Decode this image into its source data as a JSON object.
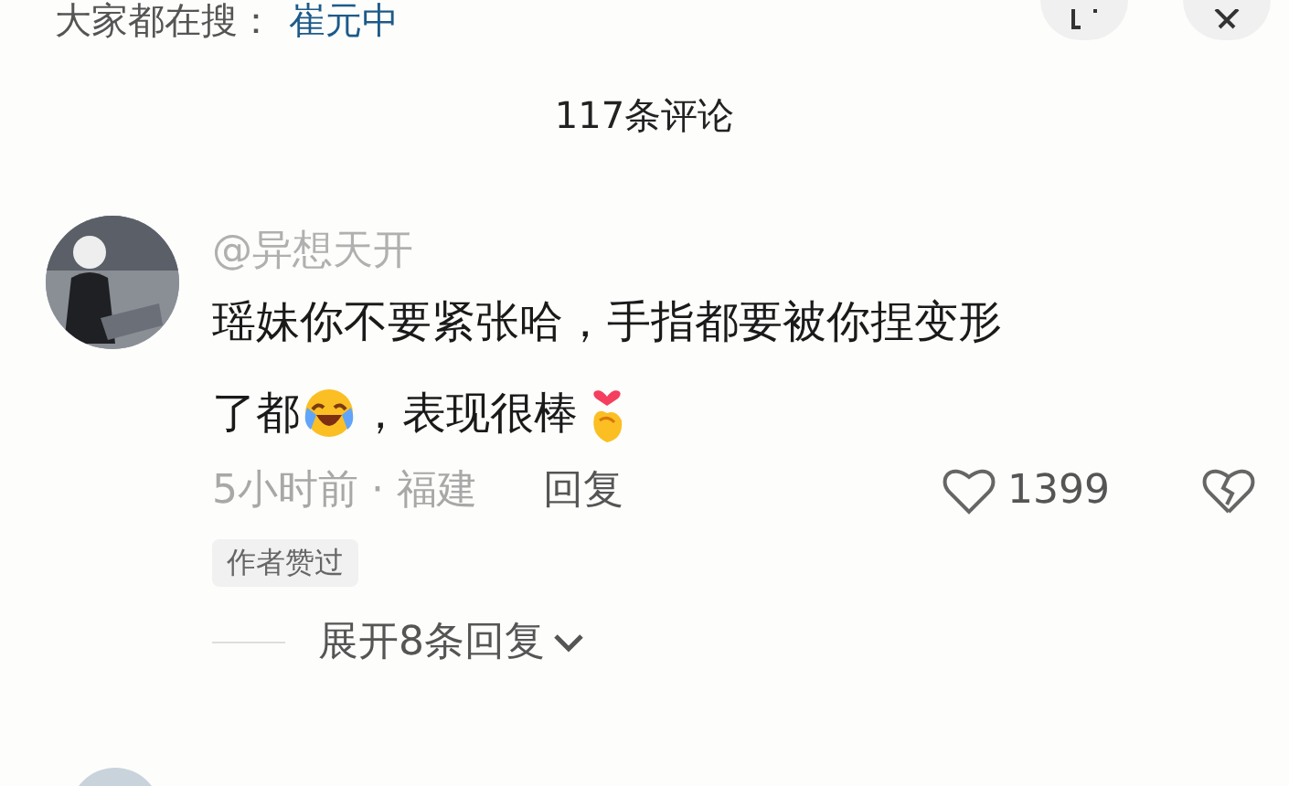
{
  "search_hint": {
    "label": "大家都在搜：",
    "term": "崔元中"
  },
  "title": "117条评论",
  "comment": {
    "username": "@异想天开",
    "lines": [
      [
        {
          "kind": "text",
          "text": "瑶妹你不要紧张哈，手指都要被你捏变形"
        }
      ],
      [
        {
          "kind": "text",
          "text": "了都"
        },
        {
          "kind": "laugh_emoji"
        },
        {
          "kind": "text",
          "text": "，表现很棒"
        },
        {
          "kind": "finger_heart_emoji"
        }
      ]
    ],
    "time": "5小时前 · 福建",
    "reply": "回复",
    "likes": "1399",
    "liked": false,
    "tag": "作者赞过",
    "expand": "展开8条回复"
  }
}
